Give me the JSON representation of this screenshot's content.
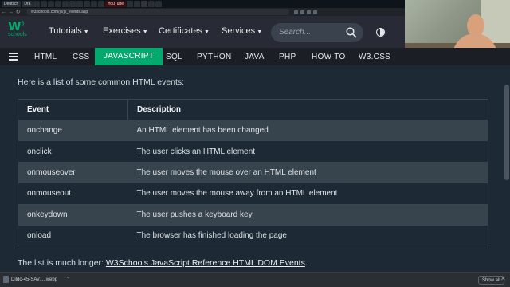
{
  "browser": {
    "tabs": [
      {
        "label": "Deutsch"
      },
      {
        "label": "Dra"
      },
      {
        "label": ""
      },
      {
        "label": ""
      },
      {
        "label": ""
      },
      {
        "label": ""
      },
      {
        "label": ""
      },
      {
        "label": ""
      },
      {
        "label": ""
      },
      {
        "label": ""
      },
      {
        "label": ""
      },
      {
        "label": ""
      },
      {
        "label": "YouTube"
      },
      {
        "label": ""
      },
      {
        "label": ""
      },
      {
        "label": ""
      },
      {
        "label": ""
      },
      {
        "label": ""
      }
    ],
    "url": "w3schools.com/js/js_events.asp"
  },
  "header": {
    "logo": {
      "main": "W",
      "sup": "3",
      "sub": "schools"
    },
    "menu": [
      {
        "label": "Tutorials"
      },
      {
        "label": "Exercises"
      },
      {
        "label": "Certificates"
      },
      {
        "label": "Services"
      }
    ],
    "search_placeholder": "Search..."
  },
  "subnav": {
    "items": [
      "HTML",
      "CSS",
      "JAVASCRIPT",
      "SQL",
      "PYTHON",
      "JAVA",
      "PHP",
      "HOW TO",
      "W3.CSS"
    ],
    "active": "JAVASCRIPT"
  },
  "content": {
    "intro": "Here is a list of some common HTML events:",
    "table": {
      "headers": [
        "Event",
        "Description"
      ],
      "rows": [
        [
          "onchange",
          "An HTML element has been changed"
        ],
        [
          "onclick",
          "The user clicks an HTML element"
        ],
        [
          "onmouseover",
          "The user moves the mouse over an HTML element"
        ],
        [
          "onmouseout",
          "The user moves the mouse away from an HTML element"
        ],
        [
          "onkeydown",
          "The user pushes a keyboard key"
        ],
        [
          "onload",
          "The browser has finished loading the page"
        ]
      ]
    },
    "outro_prefix": "The list is much longer: ",
    "outro_link": "W3Schools JavaScript Reference HTML DOM Events",
    "outro_suffix": "."
  },
  "downloads": {
    "file": "Dildo-45-SAV.....webp",
    "show_all": "Show all"
  },
  "colors": {
    "accent": "#04aa6d",
    "topnav_bg": "#282a35",
    "page_bg": "#1d2a35",
    "row_alt": "#38444d"
  },
  "icons": {
    "search": "search-icon",
    "theme": "contrast-icon",
    "menu": "hamburger-icon",
    "close": "close-icon"
  }
}
